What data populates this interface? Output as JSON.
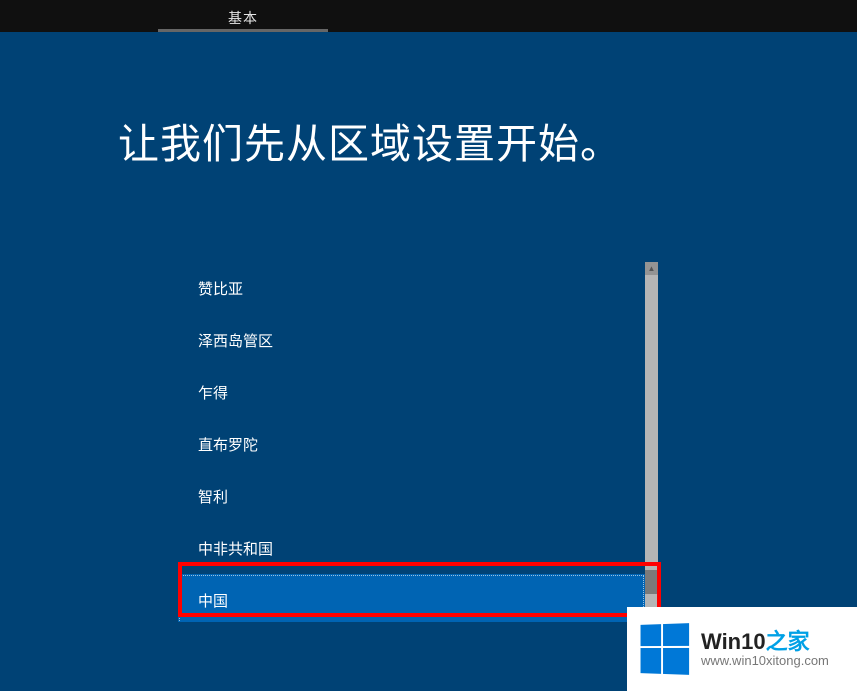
{
  "topbar": {
    "tab_basic": "基本"
  },
  "header": {
    "title": "让我们先从区域设置开始。"
  },
  "region_list": {
    "items": [
      "赞比亚",
      "泽西岛管区",
      "乍得",
      "直布罗陀",
      "智利",
      "中非共和国",
      "中国"
    ],
    "selected_index": 6
  },
  "watermark": {
    "brand_plain": "Win10",
    "brand_accent": "之家",
    "url": "www.win10xitong.com"
  }
}
